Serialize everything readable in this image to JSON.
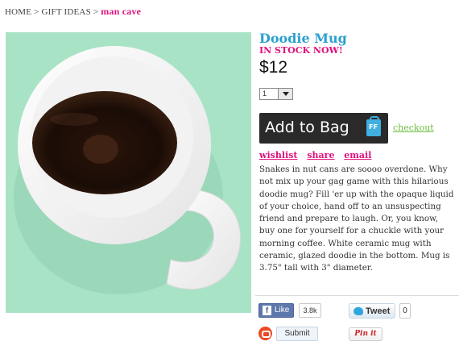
{
  "breadcrumb": {
    "home": "HOME",
    "sep1": ">",
    "gift_ideas": "GIFT IDEAS",
    "sep2": ">",
    "current": "man cave"
  },
  "product": {
    "title": "Doodie Mug",
    "stock": "IN STOCK NOW!",
    "price": "$12",
    "quantity": "1",
    "add_to_bag": "Add to Bag",
    "bag_icon_text": "FF",
    "checkout": "checkout",
    "actions": [
      "wishlist",
      "share",
      "email"
    ],
    "description": "Snakes in nut cans are soooo overdone. Why not mix up your gag game with this hilarious doodie mug? Fill 'er up with the opaque liquid of your choice, hand off to an unsuspecting friend and prepare to laugh. Or, you know, buy one for yourself for a chuckle with your morning coffee. White ceramic mug with ceramic, glazed doodie in the bottom. Mug is 3.75\" tall with 3\" diameter."
  },
  "social": {
    "fb_label": "Like",
    "fb_count": "3.8k",
    "tweet_label": "Tweet",
    "tweet_count": "0",
    "submit_label": "Submit",
    "pin_label": "Pin it"
  },
  "colors": {
    "accent_pink": "#e0127e",
    "title_blue": "#2aa0cf",
    "checkout_green": "#6bbd3c",
    "image_bg": "#a9e3c6"
  }
}
